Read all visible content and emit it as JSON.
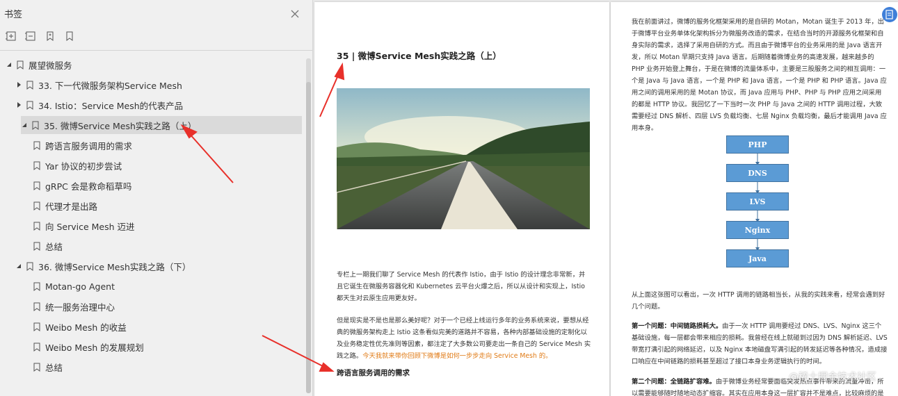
{
  "sidebar": {
    "title": "书签",
    "tools": [
      "expand-all-icon",
      "collapse-all-icon",
      "add-bookmark-icon",
      "bookmark-icon"
    ],
    "tree": [
      {
        "label": "展望微服务",
        "level": 0,
        "expanded": true
      },
      {
        "label": "33. 下一代微服务架构Service Mesh",
        "level": 1,
        "expanded": false
      },
      {
        "label": "34. Istio：Service Mesh的代表产品",
        "level": 1,
        "expanded": false
      },
      {
        "label": "35. 微博Service Mesh实践之路（上）",
        "level": 1,
        "expanded": true,
        "selected": true
      },
      {
        "label": "跨语言服务调用的需求",
        "level": 2
      },
      {
        "label": "Yar 协议的初步尝试",
        "level": 2
      },
      {
        "label": "gRPC 会是救命稻草吗",
        "level": 2
      },
      {
        "label": "代理才是出路",
        "level": 2
      },
      {
        "label": "向 Service Mesh 迈进",
        "level": 2
      },
      {
        "label": "总结",
        "level": 2
      },
      {
        "label": "36. 微博Service Mesh实践之路（下）",
        "level": 1,
        "expanded": true
      },
      {
        "label": "Motan-go Agent",
        "level": 2
      },
      {
        "label": "统一服务治理中心",
        "level": 2
      },
      {
        "label": "Weibo Mesh 的收益",
        "level": 2
      },
      {
        "label": "Weibo Mesh 的发展规划",
        "level": 2
      },
      {
        "label": "总结",
        "level": 2
      }
    ]
  },
  "left_page": {
    "chapter_title": "35 | 微博Service Mesh实践之路（上）",
    "para1": "专栏上一期我们聊了 Service Mesh 的代表作 Istio，由于 Istio 的设计理念非常新，并且它诞生在微服务容器化和 Kubernetes 云平台火爆之后，所以从设计和实现上，Istio 都天生对云原生应用更友好。",
    "para2": "但是现实是不是也是那么美好呢？对于一个已经上线运行多年的业务系统来说，要想从经典的微服务架构走上 Istio 这条看似完美的道路并不容易，各种内部基础设施的定制化以及业务稳定性优先准则等因素，都注定了大多数公司要走出一条自己的 Service Mesh 实践之路。",
    "para2_highlight": "今天我就来带你回顾下微博是如何一步步走向 Service Mesh 的。",
    "section_heading": "跨语言服务调用的需求"
  },
  "right_page": {
    "para1": "我在前面讲过，微博的服务化框架采用的是自研的 Motan，Motan 诞生于 2013 年，出于微博平台业务单体化架构拆分为微服务改造的需求，在结合当时的开源服务化框架和自身实际的需求，选择了采用自研的方式。而且由于微博平台的业务采用的是 Java 语言开发，所以 Motan 早期只支持 Java 语言。后期随着微博业务的高速发展，越来越多的 PHP 业务开始登上舞台，于是在微博的流量体系中，主要是三股服务之间的相互调用：一个是 Java 与 Java 语言，一个是 PHP 和 Java 语言，一个是 PHP 和 PHP 语言。Java 应用之间的调用采用的是 Motan 协议，而 Java 应用与 PHP、PHP 与 PHP 应用之间采用的都是 HTTP 协议。我回忆了一下当时一次 PHP 与 Java 之间的 HTTP 调用过程，大致需要经过 DNS 解析、四层 LVS 负载均衡、七层 Nginx 负载均衡，最后才能调用 Java 应用本身。",
    "flow": [
      "PHP",
      "DNS",
      "LVS",
      "Nginx",
      "Java"
    ],
    "para2": "从上面这张图可以看出，一次 HTTP 调用的链路相当长，从我的实践来看，经常会遇到好几个问题。",
    "para3_bold": "第一个问题：中间链路损耗大。",
    "para3": "由于一次 HTTP 调用要经过 DNS、LVS、Nginx 这三个基础设施，每一层都会带来相应的损耗。我曾经在线上就碰到过因为 DNS 解析延迟、LVS 带宽打满引起的网络延迟，以及 Nginx 本地磁盘写满引起的转发延迟等各种情况，造成接口响应在中间链路的损耗甚至超过了接口本身业务逻辑执行的时间。",
    "para4_bold": "第二个问题：全链路扩容难。",
    "para4": "由于微博业务经常要面临突发热点事件带来的流量冲击，所以需要能够随时随地动态扩缩容。其实在应用本身这一层扩容并不是难点，比较麻烦的是四七"
  },
  "watermark": "@稀土掘金技术社区",
  "colors": {
    "selected_row": "#dadada",
    "highlight_text": "#e07a14",
    "flow_box": "#5b9bd5",
    "arrow": "#e8302a"
  }
}
